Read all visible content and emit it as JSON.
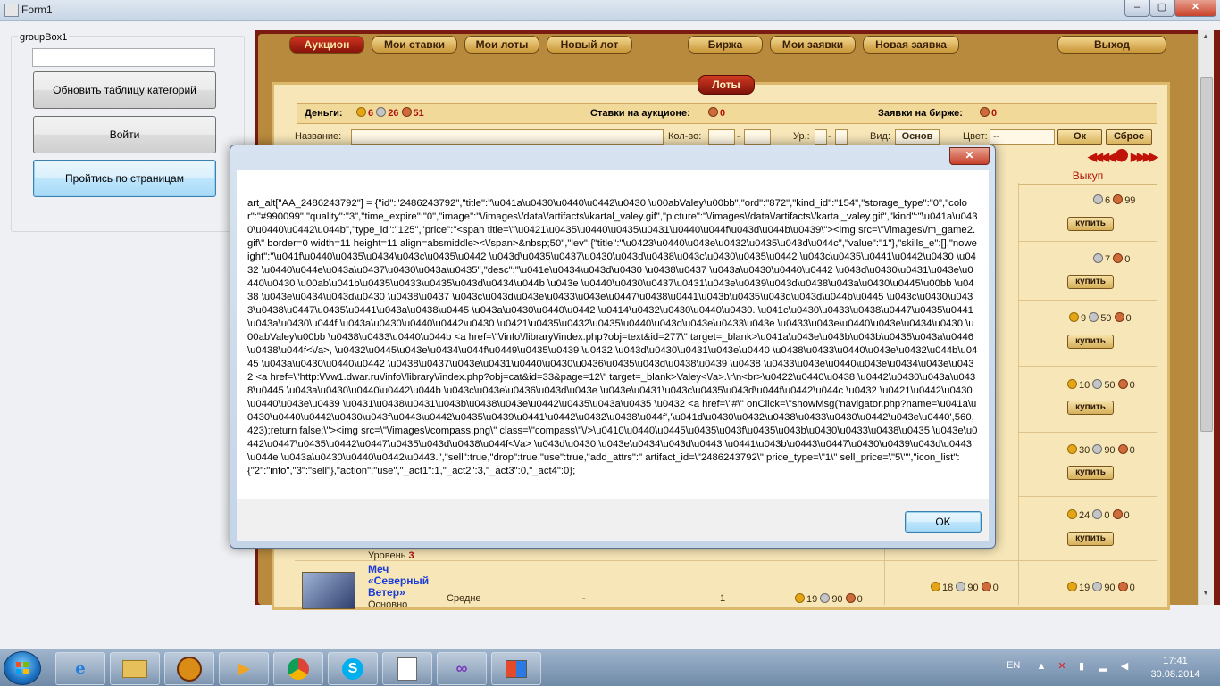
{
  "window": {
    "title": "Form1",
    "min_label": "‒",
    "max_label": "▢",
    "close_label": "✕"
  },
  "left_panel": {
    "groupbox_label": "groupBox1",
    "text_value": "",
    "btn_refresh": "Обновить таблицу категорий",
    "btn_login": "Войти",
    "btn_pages": "Пройтись по страницам"
  },
  "game": {
    "nav": [
      "Аукцион",
      "Мои ставки",
      "Мои лоты",
      "Новый лот",
      "Биржа",
      "Мои заявки",
      "Новая заявка",
      "Выход"
    ],
    "lots_tab": "Лоты",
    "money_label": "Деньги:",
    "money_gold": "6",
    "money_silver": "26",
    "money_bronze": "51",
    "bets_label": "Ставки на аукционе:",
    "bets_value": "0",
    "exchange_label": "Заявки на бирже:",
    "exchange_value": "0",
    "filter": {
      "name_label": "Название:",
      "qty_label": "Кол-во:",
      "level_label": "Ур.:",
      "dash": "-",
      "view_label": "Вид:",
      "view_value": "Основ",
      "color_label": "Цвет:",
      "color_value": "--",
      "ok_label": "Ок",
      "reset_label": "Сброс"
    },
    "buyout_header": "Выкуп",
    "buy_label": "купить",
    "rows": [
      {
        "s": "6",
        "b": "99"
      },
      {
        "s": "7",
        "b": "0"
      },
      {
        "g": "9",
        "s": "50",
        "b": "0"
      },
      {
        "g": "10",
        "s": "50",
        "b": "0"
      },
      {
        "g": "30",
        "s": "90",
        "b": "0"
      },
      {
        "g": "24",
        "s": "0",
        "b": "0"
      },
      {
        "g": "19",
        "s": "90",
        "b": "0"
      }
    ],
    "level_label": "Уровень",
    "level_value": "3",
    "item_name": "Меч «Северный Ветер»",
    "item_quality": "Средне",
    "item_dash": "-",
    "item_qty": "1",
    "price_mid": {
      "g": "19",
      "s": "90",
      "b": "0"
    },
    "price_bid": {
      "g": "18",
      "s": "90",
      "b": "0"
    },
    "item_sub": "Основно"
  },
  "dialog": {
    "message": "art_alt[\"AA_2486243792\"] = {\"id\":\"2486243792\",\"title\":\"\\u041a\\u0430\\u0440\\u0442\\u0430 \\u00abValey\\u00bb\",\"ord\":\"872\",\"kind_id\":\"154\",\"storage_type\":\"0\",\"color\":\"#990099\",\"quality\":\"3\",\"time_expire\":\"0\",\"image\":\"\\/images\\/data\\/artifacts\\/kartal_valey.gif\",\"picture\":\"\\/images\\/data\\/artifacts\\/kartal_valey.gif\",\"kind\":\"\\u041a\\u0430\\u0440\\u0442\\u044b\",\"type_id\":\"125\",\"price\":\"<span title=\\\"\\u0421\\u0435\\u0440\\u0435\\u0431\\u0440\\u044f\\u043d\\u044b\\u0439\\\"><img src=\\\"\\/images\\/m_game2.gif\\\" border=0 width=11 height=11 align=absmiddle><\\/span>&nbsp;50\",\"lev\":{\"title\":\"\\u0423\\u0440\\u043e\\u0432\\u0435\\u043d\\u044c\",\"value\":\"1\"},\"skills_e\":[],\"noweight\":\"\\u041f\\u0440\\u0435\\u0434\\u043c\\u0435\\u0442 \\u043d\\u0435\\u0437\\u0430\\u043d\\u0438\\u043c\\u0430\\u0435\\u0442 \\u043c\\u0435\\u0441\\u0442\\u0430 \\u0432 \\u0440\\u044e\\u043a\\u0437\\u0430\\u043a\\u0435\",\"desc\":\"\\u041e\\u0434\\u043d\\u0430 \\u0438\\u0437 \\u043a\\u0430\\u0440\\u0442 \\u043d\\u0430\\u0431\\u043e\\u0440\\u0430 \\u00ab\\u041b\\u0435\\u0433\\u0435\\u043d\\u0434\\u044b \\u043e \\u0440\\u0430\\u0437\\u0431\\u043e\\u0439\\u043d\\u0438\\u043a\\u0430\\u0445\\u00bb \\u0438 \\u043e\\u0434\\u043d\\u0430 \\u0438\\u0437 \\u043c\\u043d\\u043e\\u0433\\u043e\\u0447\\u0438\\u0441\\u043b\\u0435\\u043d\\u043d\\u044b\\u0445 \\u043c\\u0430\\u0433\\u0438\\u0447\\u0435\\u0441\\u043a\\u0438\\u0445 \\u043a\\u0430\\u0440\\u0442 \\u0414\\u0432\\u0430\\u0440\\u0430. \\u041c\\u0430\\u0433\\u0438\\u0447\\u0435\\u0441\\u043a\\u0430\\u044f \\u043a\\u0430\\u0440\\u0442\\u0430 \\u0421\\u0435\\u0432\\u0435\\u0440\\u043d\\u043e\\u0433\\u043e \\u0433\\u043e\\u0440\\u043e\\u0434\\u0430 \\u00abValey\\u00bb \\u0438\\u0433\\u0440\\u044b <a href=\\\"\\/info\\/library\\/index.php?obj=text&id=277\\\" target=_blank>\\u041a\\u043e\\u043b\\u043b\\u0435\\u043a\\u0446\\u0438\\u044f<\\/a>, \\u0432\\u0445\\u043e\\u0434\\u044f\\u0449\\u0435\\u0439 \\u0432 \\u043d\\u0430\\u0431\\u043e\\u0440 \\u0438\\u0433\\u0440\\u043e\\u0432\\u044b\\u0445 \\u043a\\u0430\\u0440\\u0442 \\u0438\\u0437\\u043e\\u0431\\u0440\\u0430\\u0436\\u0435\\u043d\\u0438\\u0439 \\u0438 \\u0433\\u043e\\u0440\\u043e\\u0434\\u043e\\u0432 <a href=\\\"http:\\/\\/w1.dwar.ru\\/info\\/library\\/index.php?obj=cat&id=33&page=12\\\" target=_blank>Valey<\\/a>.\\r\\n<br>\\u0422\\u0440\\u0438 \\u0442\\u0430\\u043a\\u0438\\u0445 \\u043a\\u0430\\u0440\\u0442\\u044b \\u043c\\u043e\\u0436\\u043d\\u043e \\u043e\\u0431\\u043c\\u0435\\u043d\\u044f\\u0442\\u044c \\u0432 \\u0421\\u0442\\u0430\\u0440\\u043e\\u0439 \\u0431\\u0438\\u0431\\u043b\\u0438\\u043e\\u0442\\u0435\\u043a\\u0435 \\u0432 <a href=\\\"#\\\" onClick=\\\"showMsg('navigator.php?name=\\u041a\\u0430\\u0440\\u0442\\u0430\\u043f\\u0443\\u0442\\u0435\\u0439\\u0441\\u0442\\u0432\\u0438\\u044f','\\u041d\\u0430\\u0432\\u0438\\u0433\\u0430\\u0442\\u043e\\u0440',560,423);return false;\\\"><img src=\\\"\\/images\\/compass.png\\\" class=\\\"compass\\\"\\/>\\u0410\\u0440\\u0445\\u0435\\u043f\\u0435\\u043b\\u0430\\u0433\\u0438\\u0435 \\u043e\\u0442\\u0447\\u0435\\u0442\\u0447\\u0435\\u043d\\u0438\\u044f<\\/a> \\u043d\\u0430 \\u043e\\u0434\\u043d\\u0443 \\u0441\\u043b\\u0443\\u0447\\u0430\\u0439\\u043d\\u0443\\u044e \\u043a\\u0430\\u0440\\u0442\\u0443.\",\"sell\":true,\"drop\":true,\"use\":true,\"add_attrs\":\" artifact_id=\\\"2486243792\\\" price_type=\\\"1\\\" sell_price=\\\"5\\\"\",\"icon_list\":{\"2\":\"info\",\"3\":\"sell\"},\"action\":\"use\",\"_act1\":1,\"_act2\":3,\"_act3\":0,\"_act4\":0};",
    "ok_label": "OK",
    "close_label": "✕"
  },
  "taskbar": {
    "lang": "EN",
    "time": "17:41",
    "date": "30.08.2014",
    "items": [
      "ie-icon",
      "explorer-icon",
      "game-launcher-icon",
      "media-player-icon",
      "chrome-icon",
      "skype-icon",
      "editor-icon",
      "visual-studio-icon",
      "form-app-icon"
    ]
  }
}
